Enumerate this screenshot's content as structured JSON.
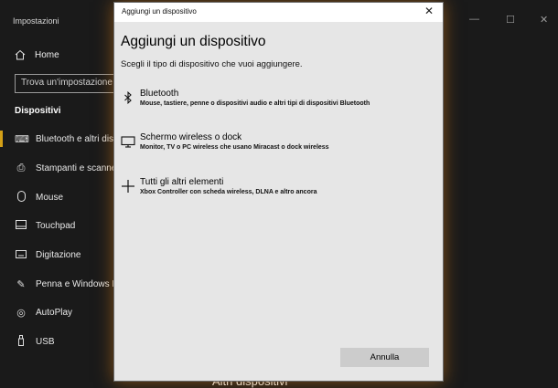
{
  "settings": {
    "title": "Impostazioni",
    "window_controls": {
      "minimize": "—",
      "maximize": "☐",
      "close": "✕"
    },
    "home_label": "Home",
    "search_placeholder": "Trova un'impostazione",
    "section_title": "Dispositivi",
    "nav_items": [
      {
        "label": "Bluetooth e altri dispositivi",
        "icon": "bluetooth-devices-icon",
        "active": true
      },
      {
        "label": "Stampanti e scanner",
        "icon": "printer-icon"
      },
      {
        "label": "Mouse",
        "icon": "mouse-icon"
      },
      {
        "label": "Touchpad",
        "icon": "touchpad-icon"
      },
      {
        "label": "Digitazione",
        "icon": "keyboard-icon"
      },
      {
        "label": "Penna e Windows Ink",
        "icon": "pen-icon"
      },
      {
        "label": "AutoPlay",
        "icon": "autoplay-icon"
      },
      {
        "label": "USB",
        "icon": "usb-icon"
      }
    ],
    "main_heading": "Altri dispositivi"
  },
  "dialog": {
    "window_title": "Aggiungi un dispositivo",
    "heading": "Aggiungi un dispositivo",
    "subtitle": "Scegli il tipo di dispositivo che vuoi aggiungere.",
    "options": [
      {
        "title": "Bluetooth",
        "description": "Mouse, tastiere, penne o dispositivi audio e altri tipi di dispositivi Bluetooth",
        "icon": "bluetooth-icon"
      },
      {
        "title": "Schermo wireless o dock",
        "description": "Monitor, TV o PC wireless che usano Miracast o dock wireless",
        "icon": "monitor-icon"
      },
      {
        "title": "Tutti gli altri elementi",
        "description": "Xbox Controller con scheda wireless, DLNA e altro ancora",
        "icon": "plus-icon"
      }
    ],
    "cancel_label": "Annulla",
    "close_glyph": "✕"
  },
  "colors": {
    "accent": "#d4a017",
    "dialog_bg": "#e6e6e6",
    "settings_bg": "#1a1a1a",
    "glow": "#d2781a"
  }
}
